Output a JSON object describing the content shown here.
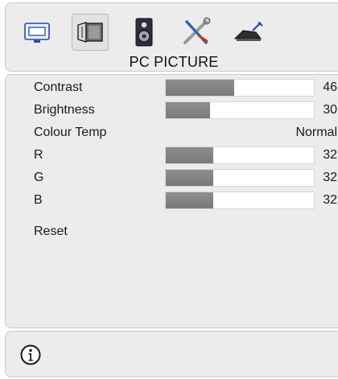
{
  "menu": {
    "title": "PC PICTURE",
    "tabs": [
      {
        "icon": "monitor-icon",
        "selected": false
      },
      {
        "icon": "picture-icon",
        "selected": true
      },
      {
        "icon": "speaker-icon",
        "selected": false
      },
      {
        "icon": "tools-icon",
        "selected": false
      },
      {
        "icon": "satellite-dish-icon",
        "selected": false
      }
    ]
  },
  "settings": {
    "contrast": {
      "label": "Contrast",
      "value": "46",
      "level": 0.46
    },
    "brightness": {
      "label": "Brightness",
      "value": "30",
      "level": 0.3
    },
    "colour_temp": {
      "label": "Colour Temp",
      "value": "Normal"
    },
    "r": {
      "label": "R",
      "value": "32",
      "level": 0.32
    },
    "g": {
      "label": "G",
      "value": "32",
      "level": 0.32
    },
    "b": {
      "label": "B",
      "value": "32",
      "level": 0.32
    },
    "reset": {
      "label": "Reset"
    }
  },
  "info": {
    "icon": "info-icon"
  },
  "colors": {
    "panel_bg": "#ececec",
    "bar_fill": "#808080",
    "bar_empty": "#ffffff"
  }
}
